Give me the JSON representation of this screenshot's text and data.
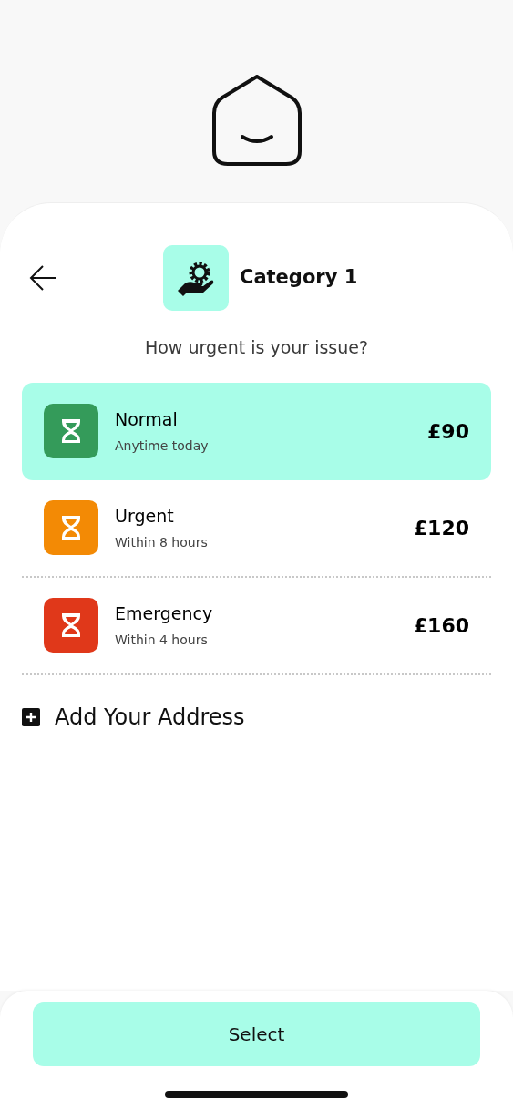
{
  "header": {
    "title": "Category 1"
  },
  "question": "How urgent is your issue?",
  "options": [
    {
      "name": "Normal",
      "detail": "Anytime today",
      "price": "£90",
      "color": "#349b5a",
      "selected": true
    },
    {
      "name": "Urgent",
      "detail": "Within 8 hours",
      "price": "£120",
      "color": "#f38a05",
      "selected": false
    },
    {
      "name": "Emergency",
      "detail": "Within 4 hours",
      "price": "£160",
      "color": "#e0381a",
      "selected": false
    }
  ],
  "add_address": "Add Your Address",
  "button": "Select"
}
